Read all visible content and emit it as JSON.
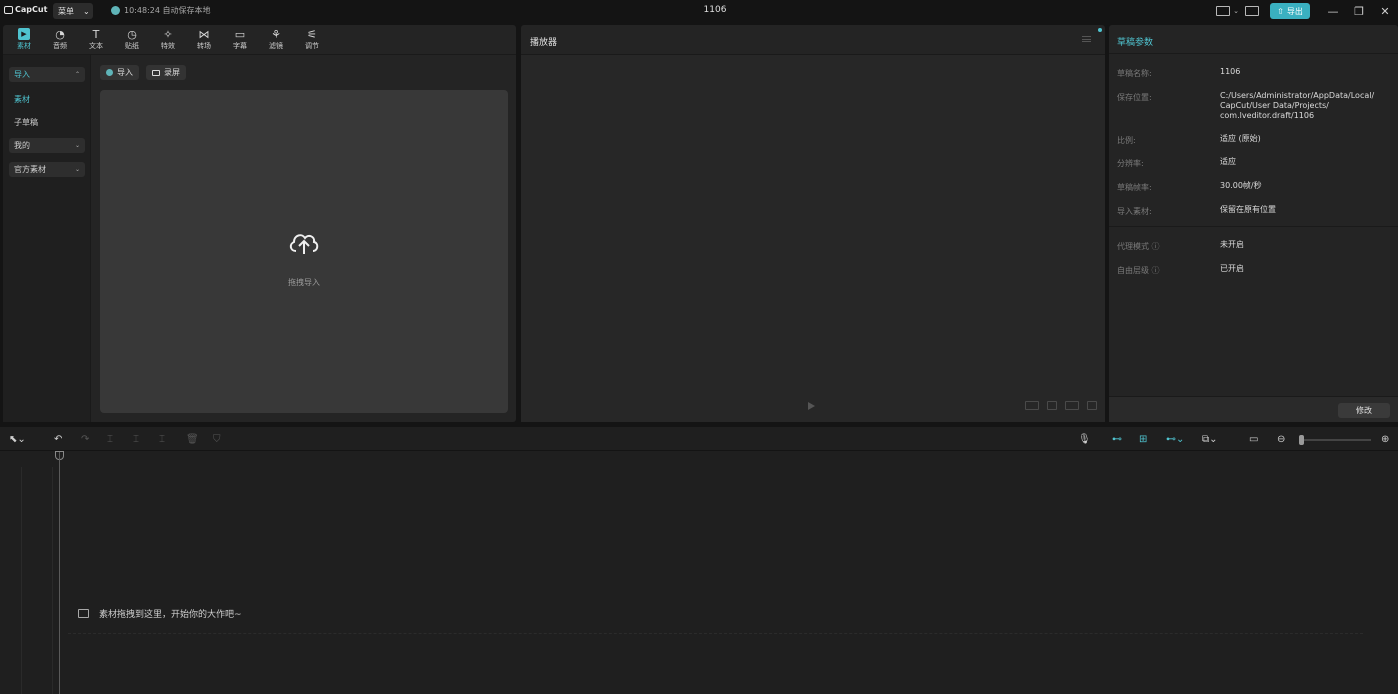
{
  "app": {
    "logo_text": "CapCut",
    "menu_label": "菜单",
    "save_status": "10:48:24 自动保存本地",
    "project_title": "1106",
    "export_label": "导出",
    "accent": "#4fc3cf",
    "export_bg": "#3ab0c0"
  },
  "media_tabs": [
    {
      "label": "素材",
      "icon": "media-icon",
      "active": true
    },
    {
      "label": "音频",
      "icon": "audio-icon"
    },
    {
      "label": "文本",
      "icon": "text-icon"
    },
    {
      "label": "贴纸",
      "icon": "sticker-icon"
    },
    {
      "label": "特效",
      "icon": "effects-icon"
    },
    {
      "label": "转场",
      "icon": "transition-icon"
    },
    {
      "label": "字幕",
      "icon": "caption-icon"
    },
    {
      "label": "滤镜",
      "icon": "filter-icon"
    },
    {
      "label": "调节",
      "icon": "adjust-icon"
    }
  ],
  "sidebar": {
    "import_label": "导入",
    "sub_items": [
      "素材",
      "子草稿"
    ],
    "mine_label": "我的",
    "official_label": "官方素材"
  },
  "import_area": {
    "import_btn": "导入",
    "record_btn": "录屏",
    "drop_text": "拖拽导入"
  },
  "player": {
    "title": "播放器"
  },
  "draft": {
    "title": "草稿参数",
    "rows": [
      {
        "label": "草稿名称:",
        "value": "1106"
      },
      {
        "label": "保存位置:",
        "value": "C:/Users/Administrator/AppData/Local/ CapCut/User Data/Projects/ com.lveditor.draft/1106"
      },
      {
        "label": "比例:",
        "value": "适应 (原始)"
      },
      {
        "label": "分辨率:",
        "value": "适应"
      },
      {
        "label": "草稿帧率:",
        "value": "30.00帧/秒"
      },
      {
        "label": "导入素材:",
        "value": "保留在原有位置"
      }
    ],
    "proxy_label": "代理模式 ⓘ",
    "proxy_value": "未开启",
    "free_layer_label": "自由层级 ⓘ",
    "free_layer_value": "已开启",
    "modify_label": "修改"
  },
  "timeline": {
    "hint": "素材拖拽到这里，开始你的大作吧~"
  }
}
